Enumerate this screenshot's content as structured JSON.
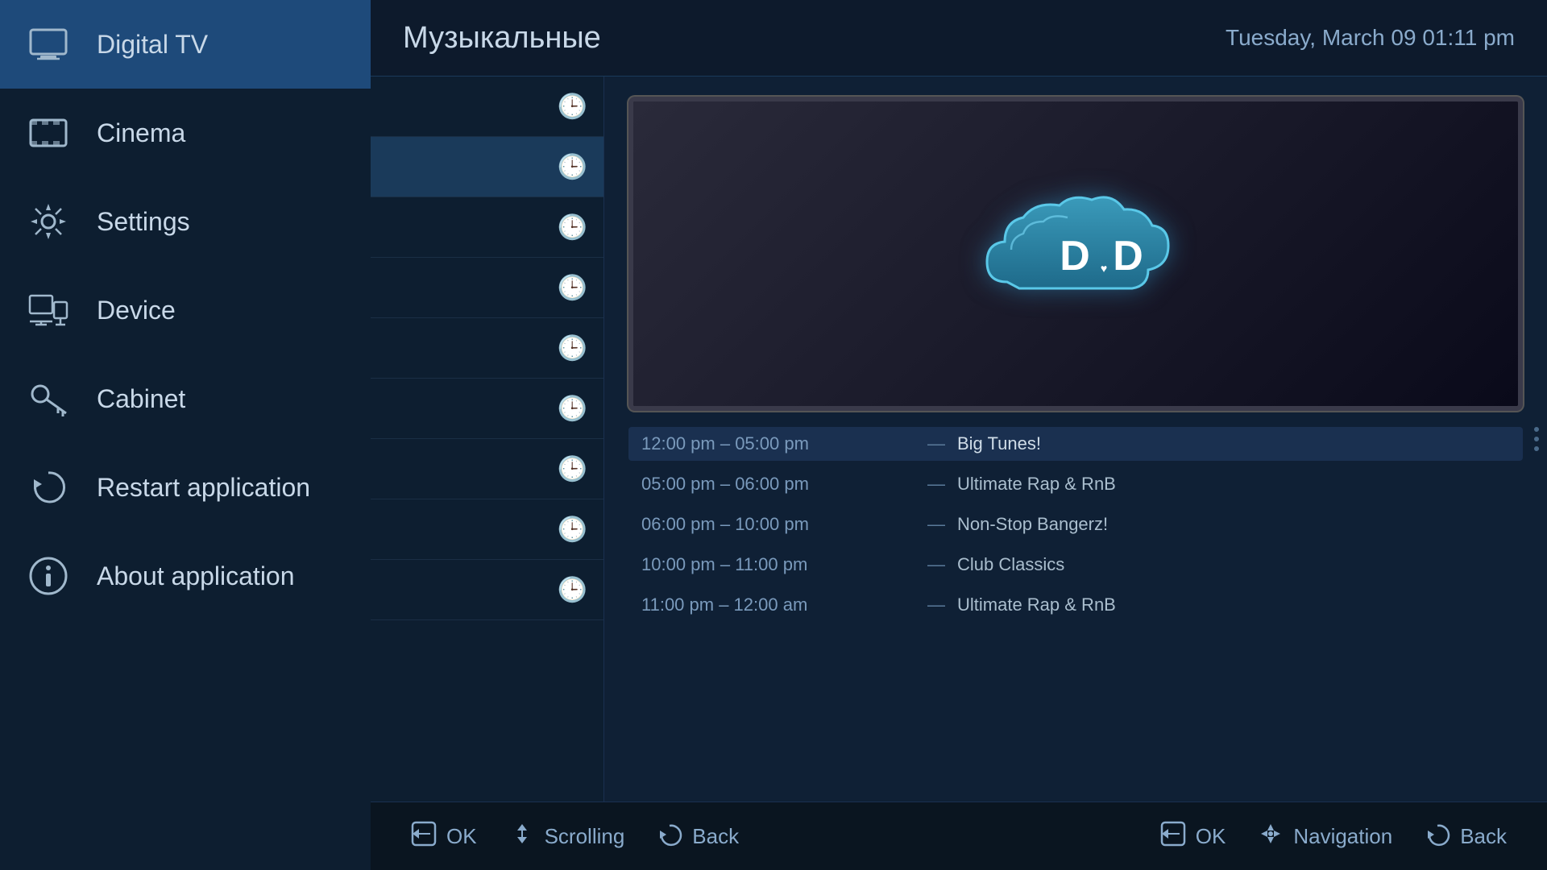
{
  "sidebar": {
    "items": [
      {
        "id": "digital-tv",
        "label": "Digital TV",
        "active": true
      },
      {
        "id": "cinema",
        "label": "Cinema",
        "active": false
      },
      {
        "id": "settings",
        "label": "Settings",
        "active": false
      },
      {
        "id": "device",
        "label": "Device",
        "active": false
      },
      {
        "id": "cabinet",
        "label": "Cabinet",
        "active": false
      },
      {
        "id": "restart",
        "label": "Restart application",
        "active": false
      },
      {
        "id": "about",
        "label": "About application",
        "active": false
      }
    ]
  },
  "header": {
    "channel_title": "Музыкальные",
    "datetime": "Tuesday, March 09    01:11 pm"
  },
  "channel_rows": [
    {
      "selected": false
    },
    {
      "selected": true
    },
    {
      "selected": false
    },
    {
      "selected": false
    },
    {
      "selected": false
    },
    {
      "selected": false
    },
    {
      "selected": false
    },
    {
      "selected": false
    },
    {
      "selected": false
    }
  ],
  "programs": [
    {
      "time": "12:00 pm – 05:00 pm",
      "dash": "—",
      "name": "Big Tunes!",
      "current": true
    },
    {
      "time": "05:00 pm – 06:00 pm",
      "dash": "—",
      "name": "Ultimate Rap & RnB",
      "current": false
    },
    {
      "time": "06:00 pm – 10:00 pm",
      "dash": "—",
      "name": "Non-Stop Bangerz!",
      "current": false
    },
    {
      "time": "10:00 pm – 11:00 pm",
      "dash": "—",
      "name": "Club Classics",
      "current": false
    },
    {
      "time": "11:00 pm – 12:00 am",
      "dash": "—",
      "name": "Ultimate Rap & RnB",
      "current": false
    }
  ],
  "bottom_left": {
    "ok_label": "OK",
    "scrolling_label": "Scrolling",
    "back_label": "Back"
  },
  "bottom_right": {
    "ok_label": "OK",
    "navigation_label": "Navigation",
    "back_label": "Back"
  },
  "cloud_logo": {
    "text": "D♥D"
  }
}
